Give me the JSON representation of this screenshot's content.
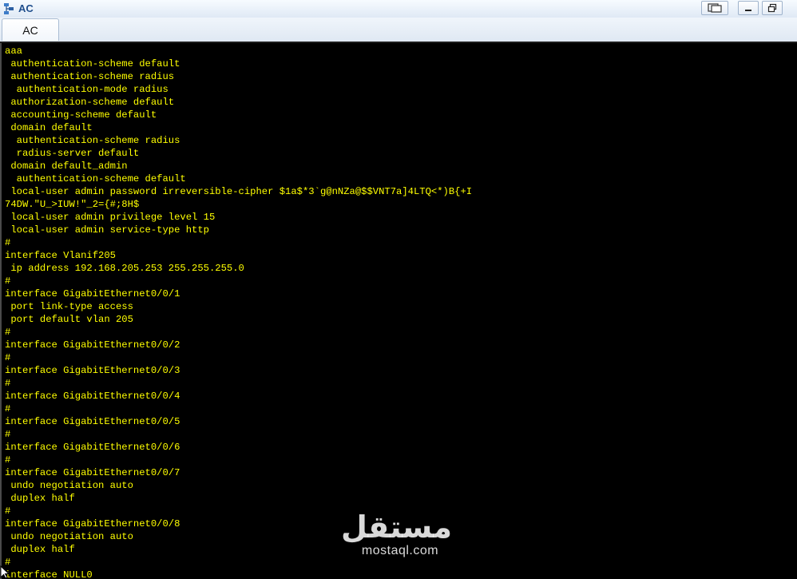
{
  "window": {
    "title": "AC",
    "controls": [
      "restore-fullscreen",
      "minimize",
      "restore"
    ]
  },
  "tabs": [
    {
      "label": "AC",
      "active": true
    }
  ],
  "terminal": {
    "text_color": "#ffff00",
    "background": "#000000",
    "lines": [
      "aaa",
      " authentication-scheme default",
      " authentication-scheme radius",
      "  authentication-mode radius",
      " authorization-scheme default",
      " accounting-scheme default",
      " domain default",
      "  authentication-scheme radius",
      "  radius-server default",
      " domain default_admin",
      "  authentication-scheme default",
      " local-user admin password irreversible-cipher $1a$*3`g@nNZa@$$VNT7a]4LTQ<*)B{+I",
      "74DW.\"U_>IUW!\"_2={#;8H$",
      " local-user admin privilege level 15",
      " local-user admin service-type http",
      "#",
      "interface Vlanif205",
      " ip address 192.168.205.253 255.255.255.0",
      "#",
      "interface GigabitEthernet0/0/1",
      " port link-type access",
      " port default vlan 205",
      "#",
      "interface GigabitEthernet0/0/2",
      "#",
      "interface GigabitEthernet0/0/3",
      "#",
      "interface GigabitEthernet0/0/4",
      "#",
      "interface GigabitEthernet0/0/5",
      "#",
      "interface GigabitEthernet0/0/6",
      "#",
      "interface GigabitEthernet0/0/7",
      " undo negotiation auto",
      " duplex half",
      "#",
      "interface GigabitEthernet0/0/8",
      " undo negotiation auto",
      " duplex half",
      "#",
      "interface NULL0"
    ]
  },
  "watermark": {
    "arabic": "مستقل",
    "latin": "mostaql.com"
  }
}
